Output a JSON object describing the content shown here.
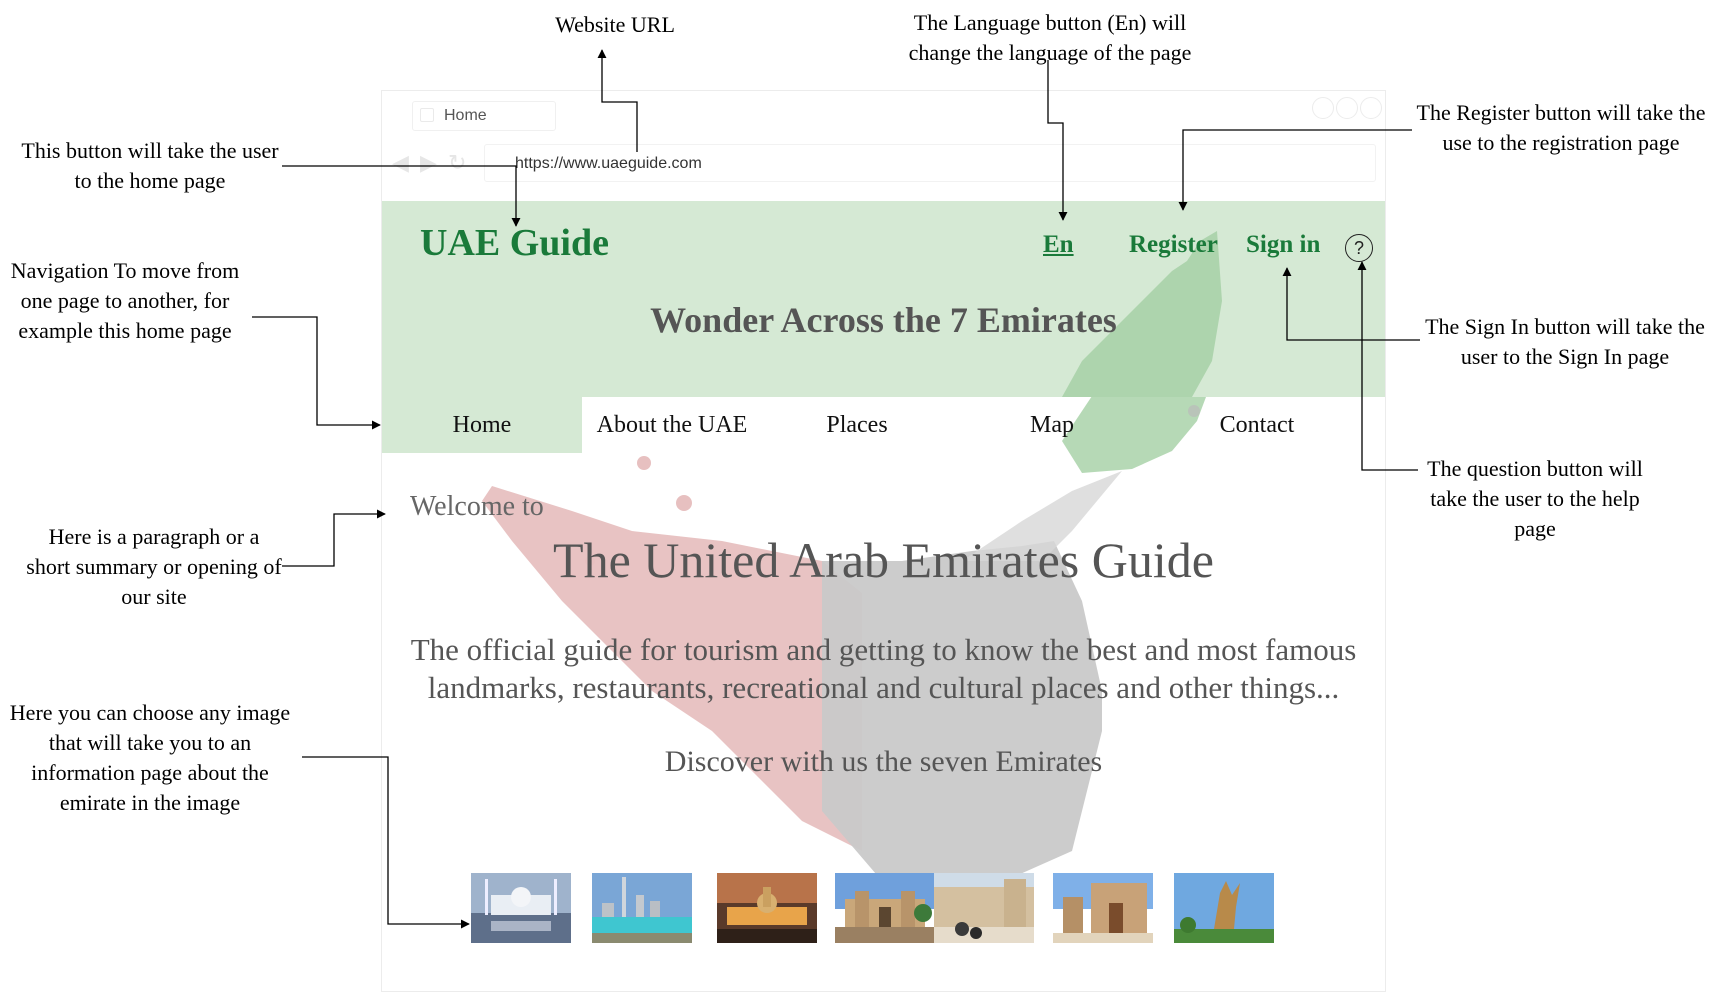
{
  "annotations": {
    "url_note": "Website URL",
    "lang_note": "The Language button (En) will change the language of the page",
    "register_note": "The Register button will take the use to the registration page",
    "home_note": "This button will take the user to the home page",
    "nav_note": "Navigation To move from one page to another, for example this home page",
    "signin_note": "The Sign In button will take the user to the Sign In page",
    "help_note": "The question button will take the user to the help page",
    "paragraph_note": "Here is a paragraph or a short summary or opening of our site",
    "images_note": "Here you can choose any image that will take you to an information page about the emirate in the image"
  },
  "browser": {
    "tab_title": "Home",
    "url": "https://www.uaeguide.com"
  },
  "header": {
    "logo": "UAE Guide",
    "language": "En",
    "register": "Register",
    "signin": "Sign in",
    "help": "?",
    "tagline": "Wonder Across the 7 Emirates"
  },
  "nav": [
    "Home",
    "About the UAE",
    "Places",
    "Map",
    "Contact"
  ],
  "main": {
    "welcome": "Welcome to",
    "title": "The United Arab Emirates Guide",
    "paragraph_line1": "The official guide for tourism and getting to know the best and most famous",
    "paragraph_line2": "landmarks, restaurants, recreational and cultural places and other things...",
    "discover": "Discover with us the seven Emirates"
  },
  "colors": {
    "header_bg": "#d5e9d4",
    "brand_green": "#1a7a3a",
    "map_red": "#e7c0c0",
    "map_grey": "#c9c9c9"
  }
}
